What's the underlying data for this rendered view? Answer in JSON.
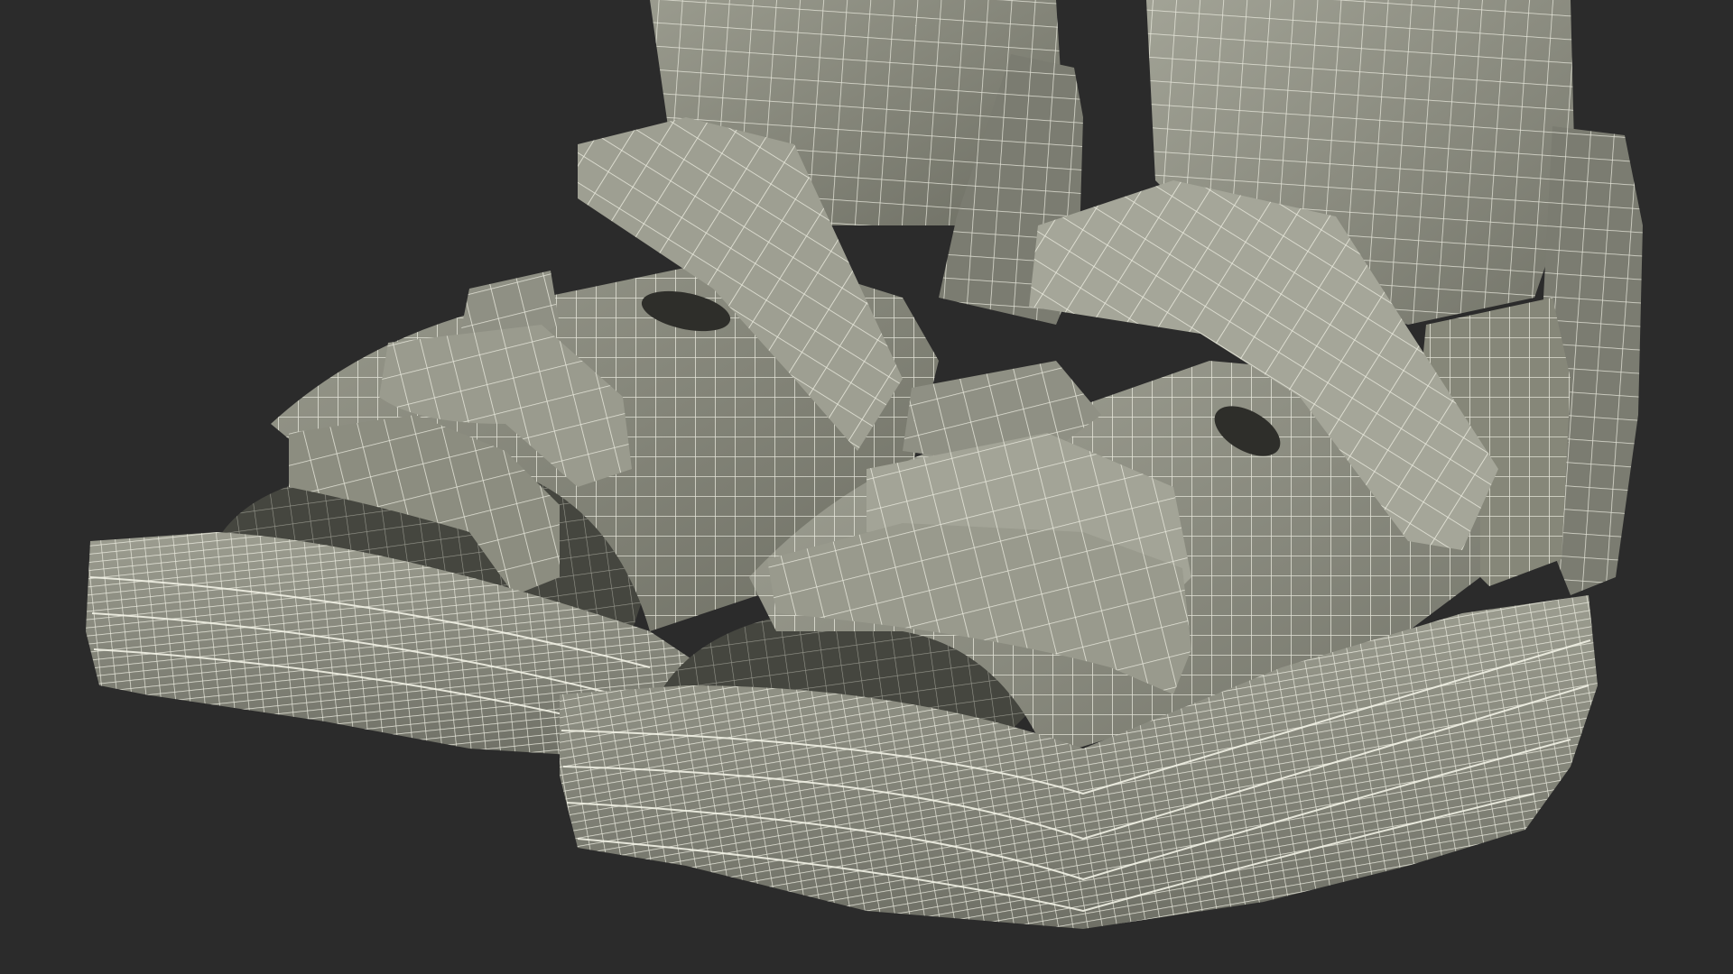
{
  "scene": {
    "subject": "pair-of-walking-boot-sandals-wireframe-render",
    "colors": {
      "background": "#2b2b2b",
      "surface": "#8c8d80",
      "surface_light": "#a3a497",
      "surface_dark": "#5e5f56",
      "wire": "#f2f2e6",
      "interior": "#4a4b44"
    }
  }
}
